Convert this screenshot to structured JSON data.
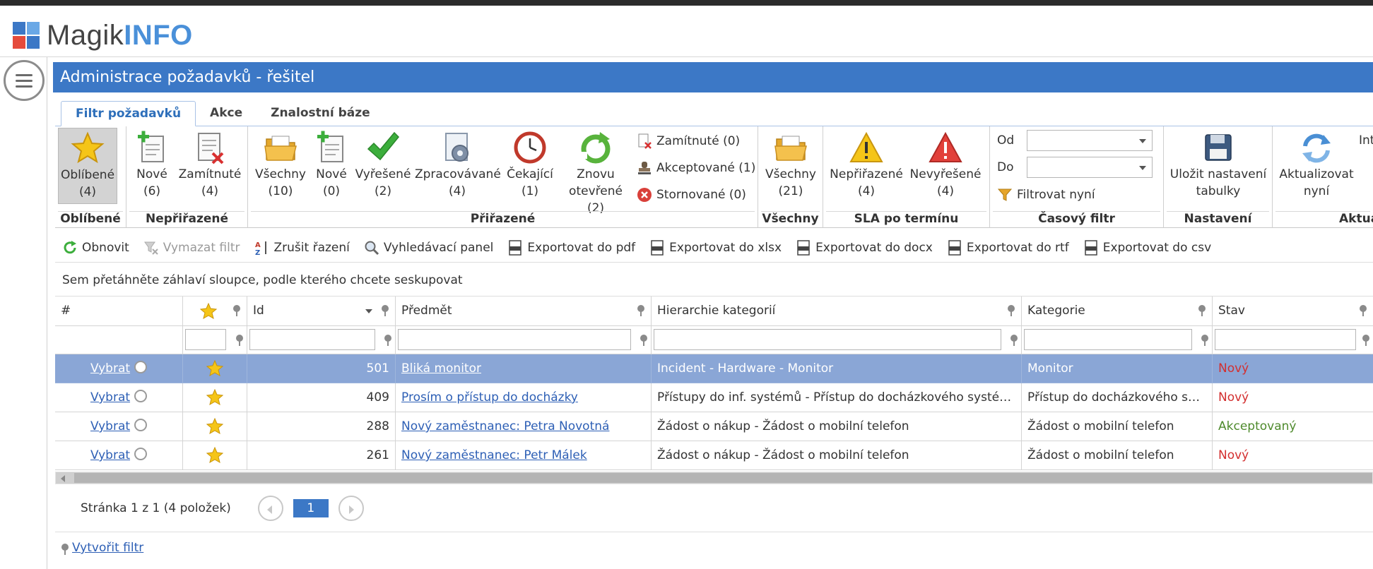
{
  "app": {
    "logo_magik": "Magik",
    "logo_info": "INFO"
  },
  "page": {
    "title": "Administrace požadavků - řešitel"
  },
  "tabs": [
    {
      "label": "Filtr požadavků",
      "active": true
    },
    {
      "label": "Akce",
      "active": false
    },
    {
      "label": "Znalostní báze",
      "active": false
    }
  ],
  "ribbon": {
    "groups": {
      "oblibene": "Oblíbené",
      "neprirazene": "Nepřiřazené",
      "prirazene": "Přiřazené",
      "vsechny": "Všechny",
      "sla": "SLA po termínu",
      "casovy": "Časový filtr",
      "nastaveni": "Nastavení",
      "aktual": "Aktua"
    },
    "buttons": {
      "oblibene": {
        "label": "Oblíbené",
        "count": "(4)"
      },
      "nove_nep": {
        "label": "Nové",
        "count": "(6)"
      },
      "zamitnute_nep": {
        "label": "Zamítnuté",
        "count": "(4)"
      },
      "vsechny_pri": {
        "label": "Všechny",
        "count": "(10)"
      },
      "nove_pri": {
        "label": "Nové",
        "count": "(0)"
      },
      "vyresene": {
        "label": "Vyřešené",
        "count": "(2)"
      },
      "zpracovavane": {
        "label": "Zpracovávané",
        "count": "(4)"
      },
      "cekajici": {
        "label": "Čekající",
        "count": "(1)"
      },
      "znovu": {
        "label": "Znovu",
        "count": "otevřené (2)"
      },
      "vsechny_all": {
        "label": "Všechny",
        "count": "(21)"
      },
      "neprirazene_sla": {
        "label": "Nepřiřazené",
        "count": "(4)"
      },
      "nevyresene_sla": {
        "label": "Nevyřešené",
        "count": "(4)"
      },
      "ulozit": {
        "label": "Uložit nastavení",
        "count": "tabulky"
      },
      "aktualizovat": {
        "label": "Aktualizovat",
        "count": "nyní"
      },
      "int": {
        "label": "Int"
      }
    },
    "small": {
      "zamitnute": "Zamítnuté (0)",
      "akceptovane": "Akceptované (1)",
      "stornovane": "Stornované (0)",
      "filtrovat": "Filtrovat nyní"
    },
    "time": {
      "od": "Od",
      "do": "Do"
    }
  },
  "toolbar": {
    "obnovit": "Obnovit",
    "vymazat": "Vymazat filtr",
    "zrusit": "Zrušit řazení",
    "vyhledavaci": "Vyhledávací panel",
    "pdf": "Exportovat do pdf",
    "xlsx": "Exportovat do xlsx",
    "docx": "Exportovat do docx",
    "rtf": "Exportovat do rtf",
    "csv": "Exportovat do csv"
  },
  "grid": {
    "group_hint": "Sem přetáhněte záhlaví sloupce, podle kterého chcete seskupovat",
    "headers": {
      "num": "#",
      "id": "Id",
      "predmet": "Předmět",
      "hierarchie": "Hierarchie kategorií",
      "kategorie": "Kategorie",
      "stav": "Stav"
    },
    "select_label": "Vybrat",
    "rows": [
      {
        "id": "501",
        "predmet": "Bliká monitor",
        "hierarchie": "Incident - Hardware - Monitor",
        "kategorie": "Monitor",
        "stav": "Nový"
      },
      {
        "id": "409",
        "predmet": "Prosím o přístup do docházky",
        "hierarchie": "Přístupy do inf. systémů - Přístup do docházkového systému",
        "kategorie": "Přístup do docházkového syst...",
        "stav": "Nový"
      },
      {
        "id": "288",
        "predmet": "Nový zaměstnanec: Petra Novotná",
        "hierarchie": "Žádost o nákup - Žádost o mobilní telefon",
        "kategorie": "Žádost o mobilní telefon",
        "stav": "Akceptovaný"
      },
      {
        "id": "261",
        "predmet": "Nový zaměstnanec: Petr Málek",
        "hierarchie": "Žádost o nákup - Žádost o mobilní telefon",
        "kategorie": "Žádost o mobilní telefon",
        "stav": "Nový"
      }
    ]
  },
  "pager": {
    "text": "Stránka 1 z 1 (4 položek)",
    "current": "1"
  },
  "footer": {
    "create_filter": "Vytvořit filtr"
  },
  "colors": {
    "accent": "#3c78c6",
    "selected_row": "#8aa6d6",
    "status_new": "#d32f2f",
    "status_accepted": "#4e8a2c"
  }
}
